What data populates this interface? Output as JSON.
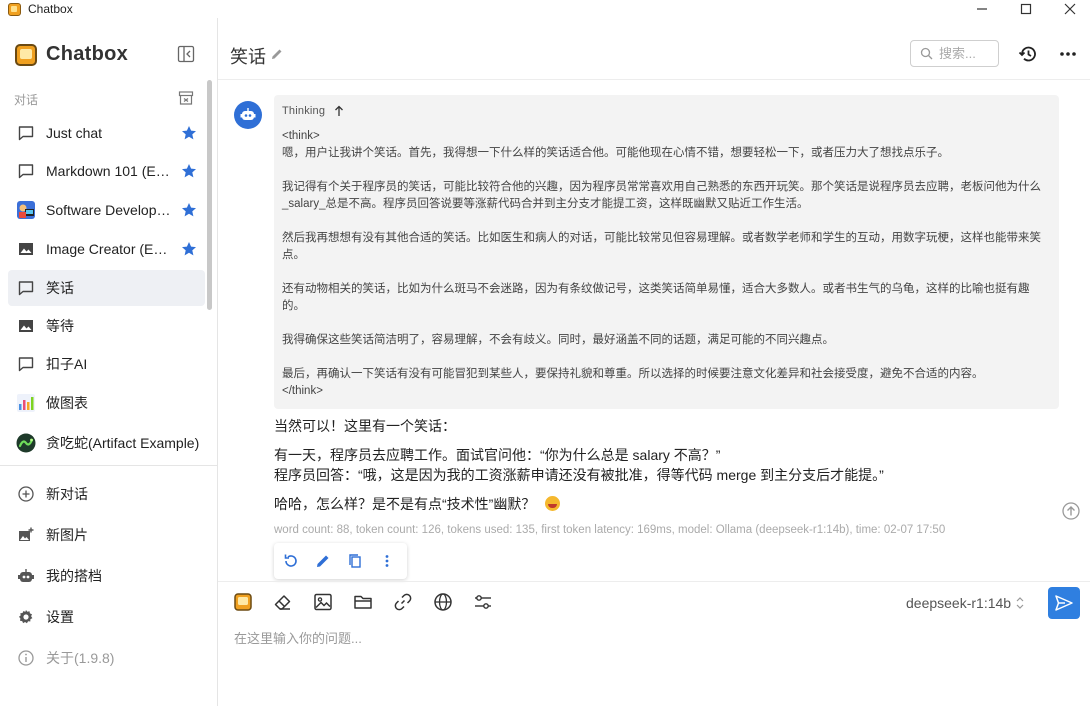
{
  "window": {
    "title": "Chatbox"
  },
  "sidebar": {
    "brand": "Chatbox",
    "section_label": "对话",
    "conversations": [
      {
        "label": "Just chat",
        "icon": "chat-bubble-icon",
        "starred": true,
        "active": false
      },
      {
        "label": "Markdown 101 (Example)",
        "icon": "chat-bubble-icon",
        "starred": true,
        "active": false
      },
      {
        "label": "Software Developer (Example)",
        "icon": "developer-avatar-icon",
        "starred": true,
        "active": false
      },
      {
        "label": "Image Creator (Example)",
        "icon": "image-icon",
        "starred": true,
        "active": false
      },
      {
        "label": "笑话",
        "icon": "chat-bubble-icon",
        "starred": false,
        "active": true
      },
      {
        "label": "等待",
        "icon": "image-icon",
        "starred": false,
        "active": false
      },
      {
        "label": "扣子AI",
        "icon": "chat-bubble-icon",
        "starred": false,
        "active": false
      },
      {
        "label": "做图表",
        "icon": "chart-avatar-icon",
        "starred": false,
        "active": false
      },
      {
        "label": "贪吃蛇(Artifact Example)",
        "icon": "snake-avatar-icon",
        "starred": false,
        "active": false
      }
    ],
    "menu": [
      {
        "label": "新对话",
        "icon": "plus-circle-icon"
      },
      {
        "label": "新图片",
        "icon": "add-image-icon"
      },
      {
        "label": "我的搭档",
        "icon": "robot-icon"
      },
      {
        "label": "设置",
        "icon": "gear-icon"
      },
      {
        "label": "关于(1.9.8)",
        "icon": "info-icon"
      }
    ]
  },
  "header": {
    "title": "笑话",
    "search_placeholder": "搜索..."
  },
  "message": {
    "thinking_label": "Thinking",
    "thinking_paragraphs": [
      "<think>",
      "嗯，用户让我讲个笑话。首先，我得想一下什么样的笑话适合他。可能他现在心情不错，想要轻松一下，或者压力大了想找点乐子。",
      "我记得有个关于程序员的笑话，可能比较符合他的兴趣，因为程序员常常喜欢用自己熟悉的东西开玩笑。那个笑话是说程序员去应聘，老板问他为什么_salary_总是不高。程序员回答说要等涨薪代码合并到主分支才能提工资，这样既幽默又贴近工作生活。",
      "然后我再想想有没有其他合适的笑话。比如医生和病人的对话，可能比较常见但容易理解。或者数学老师和学生的互动，用数字玩梗，这样也能带来笑点。",
      "还有动物相关的笑话，比如为什么斑马不会迷路，因为有条纹做记号，这类笑话简单易懂，适合大多数人。或者书生气的乌龟，这样的比喻也挺有趣的。",
      "我得确保这些笑话简洁明了，容易理解，不会有歧义。同时，最好涵盖不同的话题，满足可能的不同兴趣点。",
      "最后，再确认一下笑话有没有可能冒犯到某些人，要保持礼貌和尊重。所以选择的时候要注意文化差异和社会接受度，避免不合适的内容。",
      "</think>"
    ],
    "answer_lines": [
      "当然可以！这里有一个笑话：",
      "有一天，程序员去应聘工作。面试官问他：“你为什么总是 salary 不高？”",
      "程序员回答：“哦，这是因为我的工资涨薪申请还没有被批准，得等代码 merge 到主分支后才能提。”",
      "哈哈，怎么样？是不是有点“技术性”幽默？"
    ],
    "stats": "word count: 88, token count: 126, tokens used: 135, first token latency: 169ms, model: Ollama (deepseek-r1:14b), time: 02-07 17:50"
  },
  "input": {
    "model": "deepseek-r1:14b",
    "placeholder": "在这里输入你的问题..."
  },
  "colors": {
    "accent": "#2f7fe0",
    "star": "#2f6fd6",
    "active_bg": "#eef0f4",
    "think_bg": "#f3f3f3"
  }
}
